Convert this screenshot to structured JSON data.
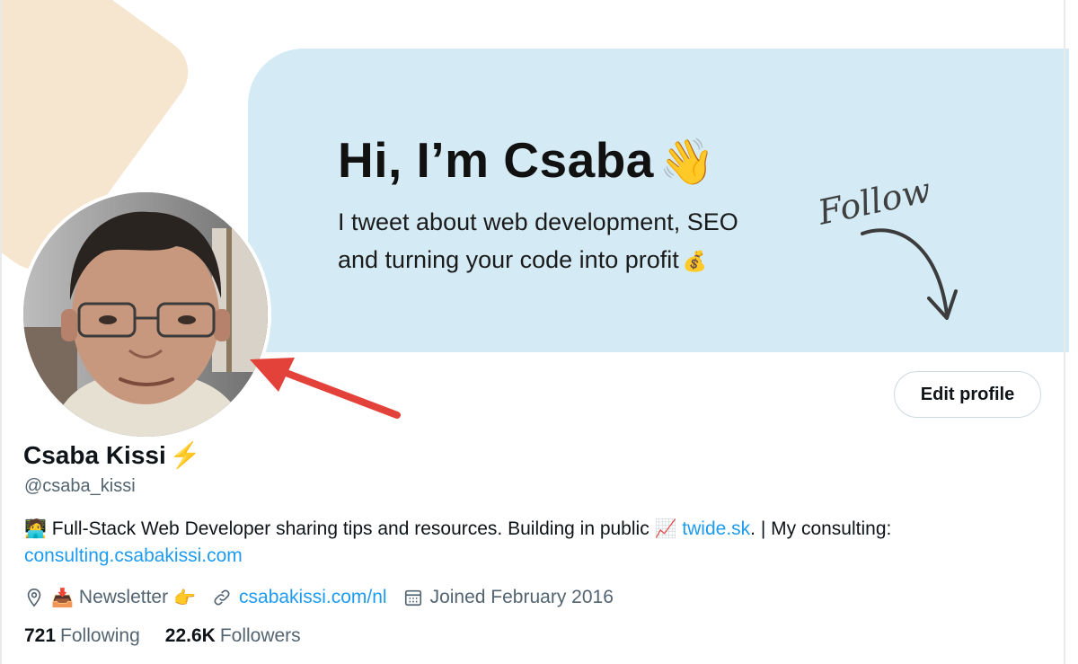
{
  "banner": {
    "title": "Hi, I’m Csaba",
    "title_icon": "waving-hand-icon",
    "subtitle_line1": "I tweet about web development, SEO",
    "subtitle_line2": "and turning your code into profit",
    "subtitle_icon": "money-bag-icon",
    "follow_label": "Follow",
    "background_color": "#d4ebf5",
    "decor_color": "#f6e6cf"
  },
  "profile": {
    "display_name": "Csaba Kissi",
    "name_icon": "lightning-bolt-icon",
    "handle": "@csaba_kissi",
    "edit_button_label": "Edit profile",
    "annotation_arrow_color": "#e3423b"
  },
  "bio": {
    "emoji": "technologist-icon",
    "text_1": "Full-Stack Web Developer sharing tips and resources. Building in public",
    "emoji2": "chart-increasing-icon",
    "link_1": "twide.sk",
    "text_2": ". | My consulting:",
    "link_2": "consulting.csabakissi.com"
  },
  "meta": {
    "location_icon": "location-pin-icon",
    "location_emoji": "inbox-tray-icon",
    "location_text": "Newsletter",
    "location_emoji_after": "pointing-right-icon",
    "link_icon": "link-icon",
    "link_text": "csabakissi.com/nl",
    "joined_icon": "calendar-icon",
    "joined_text": "Joined February 2016"
  },
  "stats": {
    "following_count": "721",
    "following_label": "Following",
    "followers_count": "22.6K",
    "followers_label": "Followers"
  },
  "colors": {
    "link": "#1d9bf0",
    "muted": "#536471",
    "text": "#0f1419"
  }
}
